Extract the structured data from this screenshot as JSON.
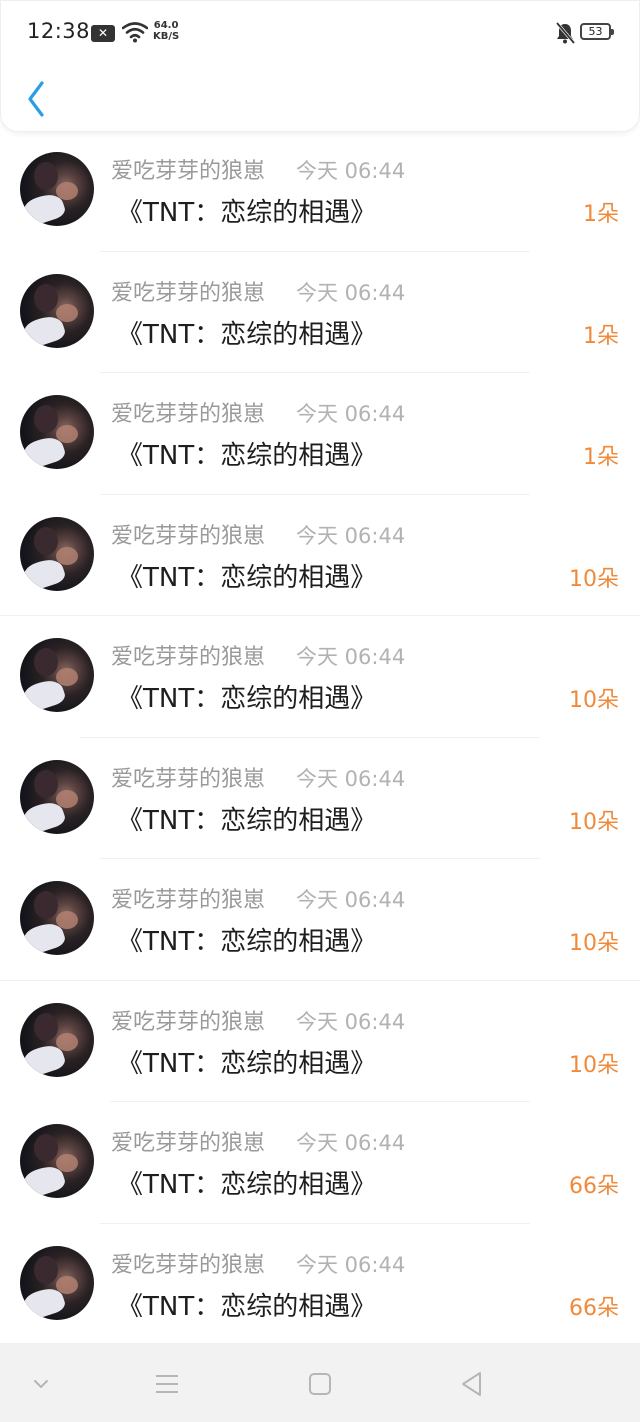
{
  "status_bar": {
    "time": "12:38",
    "net_speed_value": "64.0",
    "net_speed_unit": "KB/S",
    "battery": "53"
  },
  "icons": {
    "back": "chevron-left-icon",
    "notification_x": "close-icon",
    "wifi": "wifi-icon",
    "mute": "bell-off-icon",
    "nav_down": "chevron-down-icon",
    "nav_menu": "menu-icon",
    "nav_home": "square-icon",
    "nav_back": "triangle-back-icon"
  },
  "colors": {
    "accent": "#2a9de8",
    "amount": "#f08a3a",
    "sender": "#9a9a9a",
    "title": "#1e1e1e"
  },
  "items": [
    {
      "sender": "爱吃芽芽的狼崽",
      "time": "今天 06:44",
      "title": "《TNT：恋综的相遇》",
      "amount": "1朵"
    },
    {
      "sender": "爱吃芽芽的狼崽",
      "time": "今天 06:44",
      "title": "《TNT：恋综的相遇》",
      "amount": "1朵"
    },
    {
      "sender": "爱吃芽芽的狼崽",
      "time": "今天 06:44",
      "title": "《TNT：恋综的相遇》",
      "amount": "1朵"
    },
    {
      "sender": "爱吃芽芽的狼崽",
      "time": "今天 06:44",
      "title": "《TNT：恋综的相遇》",
      "amount": "10朵"
    },
    {
      "sender": "爱吃芽芽的狼崽",
      "time": "今天 06:44",
      "title": "《TNT：恋综的相遇》",
      "amount": "10朵"
    },
    {
      "sender": "爱吃芽芽的狼崽",
      "time": "今天 06:44",
      "title": "《TNT：恋综的相遇》",
      "amount": "10朵"
    },
    {
      "sender": "爱吃芽芽的狼崽",
      "time": "今天 06:44",
      "title": "《TNT：恋综的相遇》",
      "amount": "10朵"
    },
    {
      "sender": "爱吃芽芽的狼崽",
      "time": "今天 06:44",
      "title": "《TNT：恋综的相遇》",
      "amount": "10朵"
    },
    {
      "sender": "爱吃芽芽的狼崽",
      "time": "今天 06:44",
      "title": "《TNT：恋综的相遇》",
      "amount": "66朵"
    },
    {
      "sender": "爱吃芽芽的狼崽",
      "time": "今天 06:44",
      "title": "《TNT：恋综的相遇》",
      "amount": "66朵"
    }
  ]
}
